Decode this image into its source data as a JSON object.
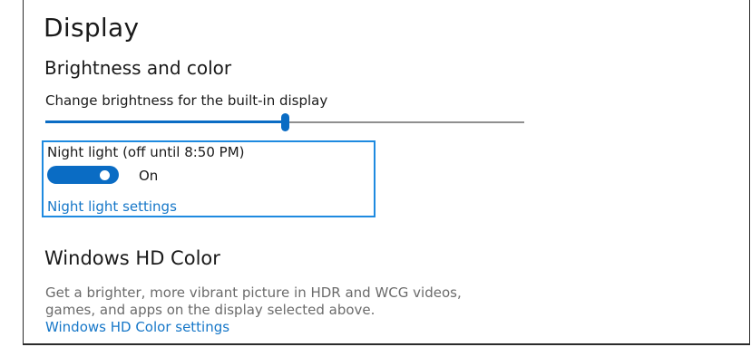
{
  "page": {
    "title": "Display"
  },
  "brightness_color": {
    "heading": "Brightness and color",
    "slider_label": "Change brightness for the built-in display",
    "brightness_value": 0.5,
    "accent_color": "#0a6cc4"
  },
  "night_light": {
    "label": "Night light (off until 8:50 PM)",
    "toggle_state": "On",
    "toggle_on": true,
    "settings_link": "Night light settings",
    "focus_color": "#1e8ae0"
  },
  "hd_color": {
    "heading": "Windows HD Color",
    "description_line1": "Get a brighter, more vibrant picture in HDR and WCG videos,",
    "description_line2": "games, and apps on the display selected above.",
    "settings_link": "Windows HD Color settings",
    "link_color": "#1677c8"
  }
}
